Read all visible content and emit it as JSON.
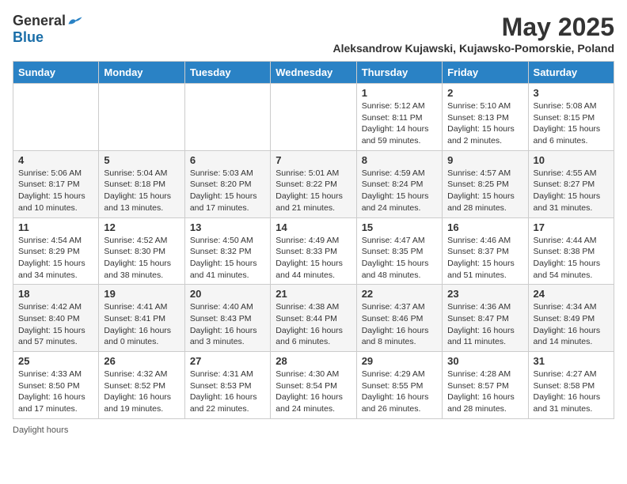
{
  "header": {
    "logo_general": "General",
    "logo_blue": "Blue",
    "month_title": "May 2025",
    "subtitle": "Aleksandrow Kujawski, Kujawsko-Pomorskie, Poland"
  },
  "days_of_week": [
    "Sunday",
    "Monday",
    "Tuesday",
    "Wednesday",
    "Thursday",
    "Friday",
    "Saturday"
  ],
  "weeks": [
    [
      {
        "day": "",
        "info": ""
      },
      {
        "day": "",
        "info": ""
      },
      {
        "day": "",
        "info": ""
      },
      {
        "day": "",
        "info": ""
      },
      {
        "day": "1",
        "info": "Sunrise: 5:12 AM\nSunset: 8:11 PM\nDaylight: 14 hours\nand 59 minutes."
      },
      {
        "day": "2",
        "info": "Sunrise: 5:10 AM\nSunset: 8:13 PM\nDaylight: 15 hours\nand 2 minutes."
      },
      {
        "day": "3",
        "info": "Sunrise: 5:08 AM\nSunset: 8:15 PM\nDaylight: 15 hours\nand 6 minutes."
      }
    ],
    [
      {
        "day": "4",
        "info": "Sunrise: 5:06 AM\nSunset: 8:17 PM\nDaylight: 15 hours\nand 10 minutes."
      },
      {
        "day": "5",
        "info": "Sunrise: 5:04 AM\nSunset: 8:18 PM\nDaylight: 15 hours\nand 13 minutes."
      },
      {
        "day": "6",
        "info": "Sunrise: 5:03 AM\nSunset: 8:20 PM\nDaylight: 15 hours\nand 17 minutes."
      },
      {
        "day": "7",
        "info": "Sunrise: 5:01 AM\nSunset: 8:22 PM\nDaylight: 15 hours\nand 21 minutes."
      },
      {
        "day": "8",
        "info": "Sunrise: 4:59 AM\nSunset: 8:24 PM\nDaylight: 15 hours\nand 24 minutes."
      },
      {
        "day": "9",
        "info": "Sunrise: 4:57 AM\nSunset: 8:25 PM\nDaylight: 15 hours\nand 28 minutes."
      },
      {
        "day": "10",
        "info": "Sunrise: 4:55 AM\nSunset: 8:27 PM\nDaylight: 15 hours\nand 31 minutes."
      }
    ],
    [
      {
        "day": "11",
        "info": "Sunrise: 4:54 AM\nSunset: 8:29 PM\nDaylight: 15 hours\nand 34 minutes."
      },
      {
        "day": "12",
        "info": "Sunrise: 4:52 AM\nSunset: 8:30 PM\nDaylight: 15 hours\nand 38 minutes."
      },
      {
        "day": "13",
        "info": "Sunrise: 4:50 AM\nSunset: 8:32 PM\nDaylight: 15 hours\nand 41 minutes."
      },
      {
        "day": "14",
        "info": "Sunrise: 4:49 AM\nSunset: 8:33 PM\nDaylight: 15 hours\nand 44 minutes."
      },
      {
        "day": "15",
        "info": "Sunrise: 4:47 AM\nSunset: 8:35 PM\nDaylight: 15 hours\nand 48 minutes."
      },
      {
        "day": "16",
        "info": "Sunrise: 4:46 AM\nSunset: 8:37 PM\nDaylight: 15 hours\nand 51 minutes."
      },
      {
        "day": "17",
        "info": "Sunrise: 4:44 AM\nSunset: 8:38 PM\nDaylight: 15 hours\nand 54 minutes."
      }
    ],
    [
      {
        "day": "18",
        "info": "Sunrise: 4:42 AM\nSunset: 8:40 PM\nDaylight: 15 hours\nand 57 minutes."
      },
      {
        "day": "19",
        "info": "Sunrise: 4:41 AM\nSunset: 8:41 PM\nDaylight: 16 hours\nand 0 minutes."
      },
      {
        "day": "20",
        "info": "Sunrise: 4:40 AM\nSunset: 8:43 PM\nDaylight: 16 hours\nand 3 minutes."
      },
      {
        "day": "21",
        "info": "Sunrise: 4:38 AM\nSunset: 8:44 PM\nDaylight: 16 hours\nand 6 minutes."
      },
      {
        "day": "22",
        "info": "Sunrise: 4:37 AM\nSunset: 8:46 PM\nDaylight: 16 hours\nand 8 minutes."
      },
      {
        "day": "23",
        "info": "Sunrise: 4:36 AM\nSunset: 8:47 PM\nDaylight: 16 hours\nand 11 minutes."
      },
      {
        "day": "24",
        "info": "Sunrise: 4:34 AM\nSunset: 8:49 PM\nDaylight: 16 hours\nand 14 minutes."
      }
    ],
    [
      {
        "day": "25",
        "info": "Sunrise: 4:33 AM\nSunset: 8:50 PM\nDaylight: 16 hours\nand 17 minutes."
      },
      {
        "day": "26",
        "info": "Sunrise: 4:32 AM\nSunset: 8:52 PM\nDaylight: 16 hours\nand 19 minutes."
      },
      {
        "day": "27",
        "info": "Sunrise: 4:31 AM\nSunset: 8:53 PM\nDaylight: 16 hours\nand 22 minutes."
      },
      {
        "day": "28",
        "info": "Sunrise: 4:30 AM\nSunset: 8:54 PM\nDaylight: 16 hours\nand 24 minutes."
      },
      {
        "day": "29",
        "info": "Sunrise: 4:29 AM\nSunset: 8:55 PM\nDaylight: 16 hours\nand 26 minutes."
      },
      {
        "day": "30",
        "info": "Sunrise: 4:28 AM\nSunset: 8:57 PM\nDaylight: 16 hours\nand 28 minutes."
      },
      {
        "day": "31",
        "info": "Sunrise: 4:27 AM\nSunset: 8:58 PM\nDaylight: 16 hours\nand 31 minutes."
      }
    ]
  ],
  "footer": {
    "daylight_hours_label": "Daylight hours"
  }
}
